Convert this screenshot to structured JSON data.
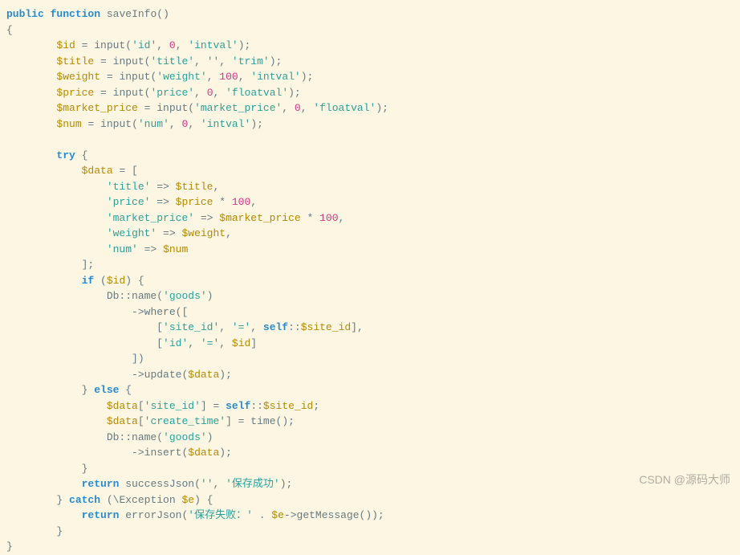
{
  "code": {
    "fn_visibility": "public",
    "fn_kw": "function",
    "fn_name": "saveInfo",
    "input_fn": "input",
    "vars": {
      "id": "$id",
      "title": "$title",
      "weight": "$weight",
      "price": "$price",
      "market_price": "$market_price",
      "num": "$num",
      "data": "$data",
      "e": "$e"
    },
    "strings": {
      "id": "'id'",
      "title": "'title'",
      "empty": "''",
      "trim": "'trim'",
      "weight": "'weight'",
      "intval": "'intval'",
      "price": "'price'",
      "floatval": "'floatval'",
      "market_price": "'market_price'",
      "num": "'num'",
      "goods": "'goods'",
      "site_id": "'site_id'",
      "eq": "'='",
      "create_time": "'create_time'",
      "save_ok": "'保存成功'",
      "save_fail": "'保存失败：'"
    },
    "nums": {
      "zero": "0",
      "hundred": "100"
    },
    "kw": {
      "try": "try",
      "if": "if",
      "else": "else",
      "return": "return",
      "catch": "catch",
      "self": "self"
    },
    "calls": {
      "db_name": "Db::name",
      "where": "where",
      "update": "update",
      "insert": "insert",
      "time": "time",
      "successJson": "successJson",
      "errorJson": "errorJson",
      "getMessage": "getMessage",
      "exception": "\\Exception"
    },
    "props": {
      "site_id": "$site_id"
    }
  },
  "watermark": "CSDN @源码大师"
}
